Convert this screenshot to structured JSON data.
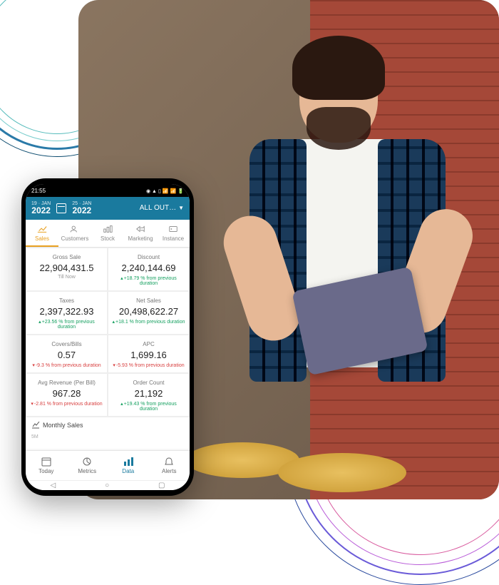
{
  "statusbar": {
    "time": "21:55"
  },
  "header": {
    "date_start_day": "19 · JAN",
    "date_start_year": "2022",
    "date_end_day": "25 · JAN",
    "date_end_year": "2022",
    "outlet_label": "ALL OUT…"
  },
  "tabs": [
    {
      "label": "Sales",
      "active": true
    },
    {
      "label": "Customers",
      "active": false
    },
    {
      "label": "Stock",
      "active": false
    },
    {
      "label": "Marketing",
      "active": false
    },
    {
      "label": "Instance",
      "active": false
    }
  ],
  "metrics": [
    {
      "label": "Gross Sale",
      "value": "22,904,431.5",
      "sub": "Till Now",
      "change": "",
      "dir": ""
    },
    {
      "label": "Discount",
      "value": "2,240,144.69",
      "sub": "",
      "change": "+18.79 % from previous duration",
      "dir": "up"
    },
    {
      "label": "Taxes",
      "value": "2,397,322.93",
      "sub": "",
      "change": "+23.56 % from previous duration",
      "dir": "up"
    },
    {
      "label": "Net Sales",
      "value": "20,498,622.27",
      "sub": "",
      "change": "+18.1 % from previous duration",
      "dir": "up"
    },
    {
      "label": "Covers/Bills",
      "value": "0.57",
      "sub": "",
      "change": "-9.3 % from previous duration",
      "dir": "down"
    },
    {
      "label": "APC",
      "value": "1,699.16",
      "sub": "",
      "change": "-5.93 % from previous duration",
      "dir": "down"
    },
    {
      "label": "Avg Revenue (Per Bill)",
      "value": "967.28",
      "sub": "",
      "change": "-2.81 % from previous duration",
      "dir": "down"
    },
    {
      "label": "Order Count",
      "value": "21,192",
      "sub": "",
      "change": "+19.43 % from previous duration",
      "dir": "up"
    }
  ],
  "chart_section": {
    "title": "Monthly Sales",
    "axis_label": "5M"
  },
  "bottom_nav": [
    {
      "label": "Today",
      "active": false
    },
    {
      "label": "Metrics",
      "active": false
    },
    {
      "label": "Data",
      "active": true
    },
    {
      "label": "Alerts",
      "active": false
    }
  ]
}
